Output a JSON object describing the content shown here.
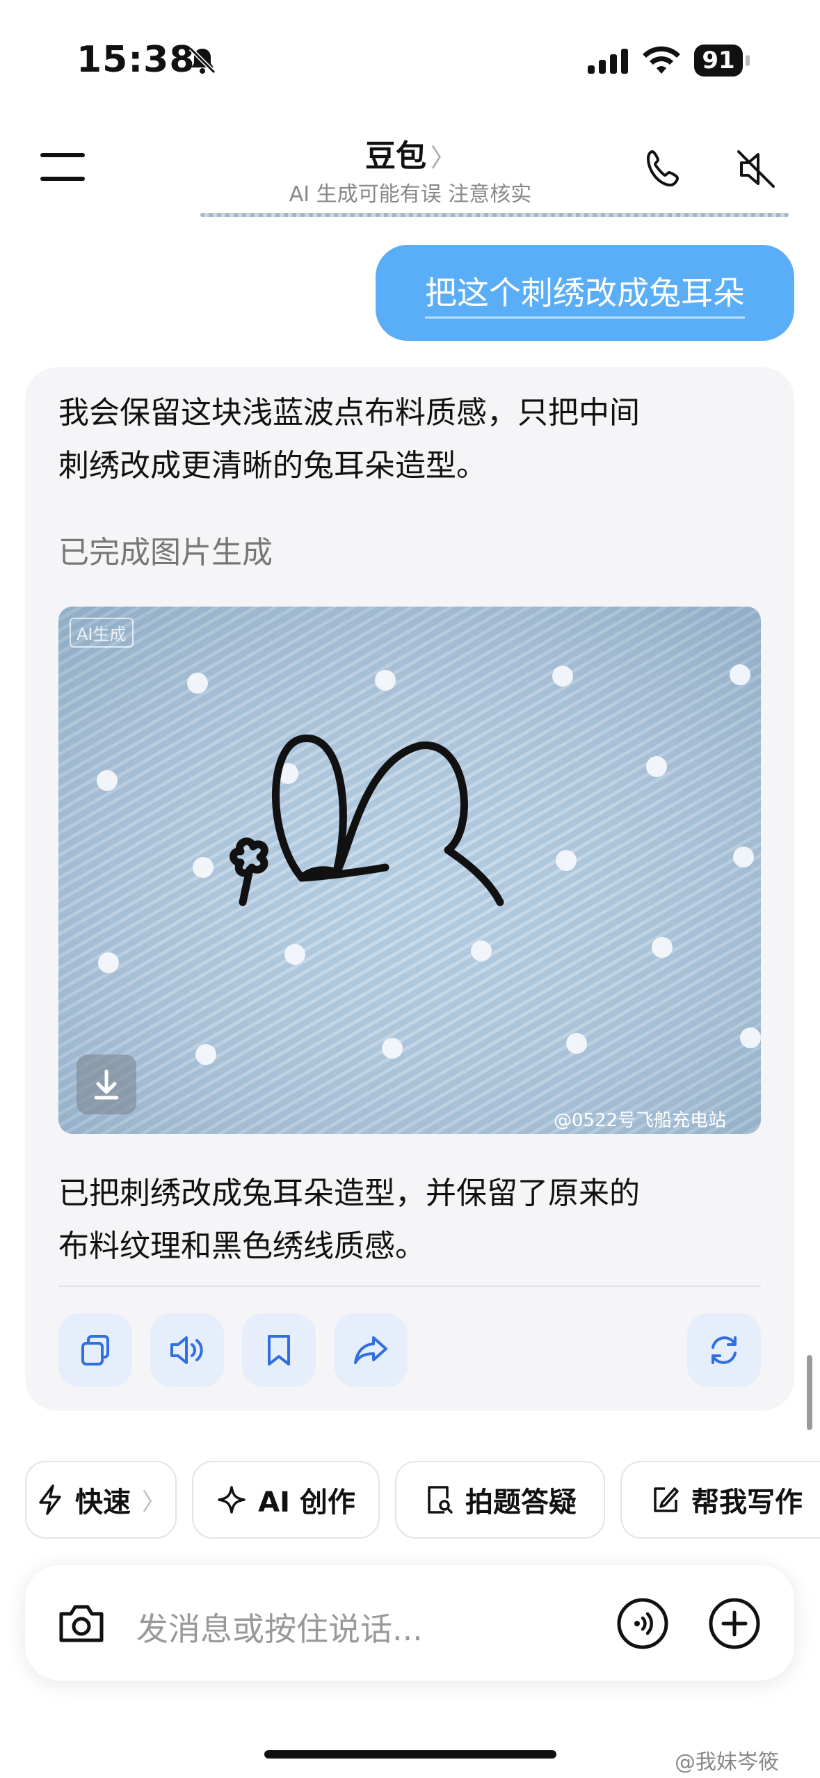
{
  "status": {
    "time": "15:38",
    "battery": "91"
  },
  "header": {
    "title": "豆包",
    "chevron": "〉",
    "subtitle": "AI 生成可能有误 注意核实"
  },
  "user_message": "把这个刺绣改成兔耳朵",
  "assistant": {
    "intro": [
      "我会保留这块浅蓝波点布料质感，只把中间",
      "刺绣改成更清晰的兔耳朵造型。"
    ],
    "status_label": "已完成图片生成",
    "image_badge": "AI生成",
    "image_watermark": "@0522号飞船充电站",
    "result": [
      "已把刺绣改成兔耳朵造型，并保留了原来的",
      "布料纹理和黑色绣线质感。"
    ]
  },
  "chips": [
    {
      "label": "快速",
      "icon": "lightning-icon",
      "chevron": "〉"
    },
    {
      "label": "AI 创作",
      "icon": "sparkle-icon"
    },
    {
      "label": "拍题答疑",
      "icon": "search-doc-icon"
    },
    {
      "label": "帮我写作",
      "icon": "edit-icon"
    }
  ],
  "input": {
    "placeholder": "发消息或按住说话..."
  },
  "page_watermark": "@我妹岑筱",
  "colors": {
    "accent": "#5aaef7",
    "action_icon": "#2f6fe0",
    "card_bg": "#f5f5f7"
  }
}
